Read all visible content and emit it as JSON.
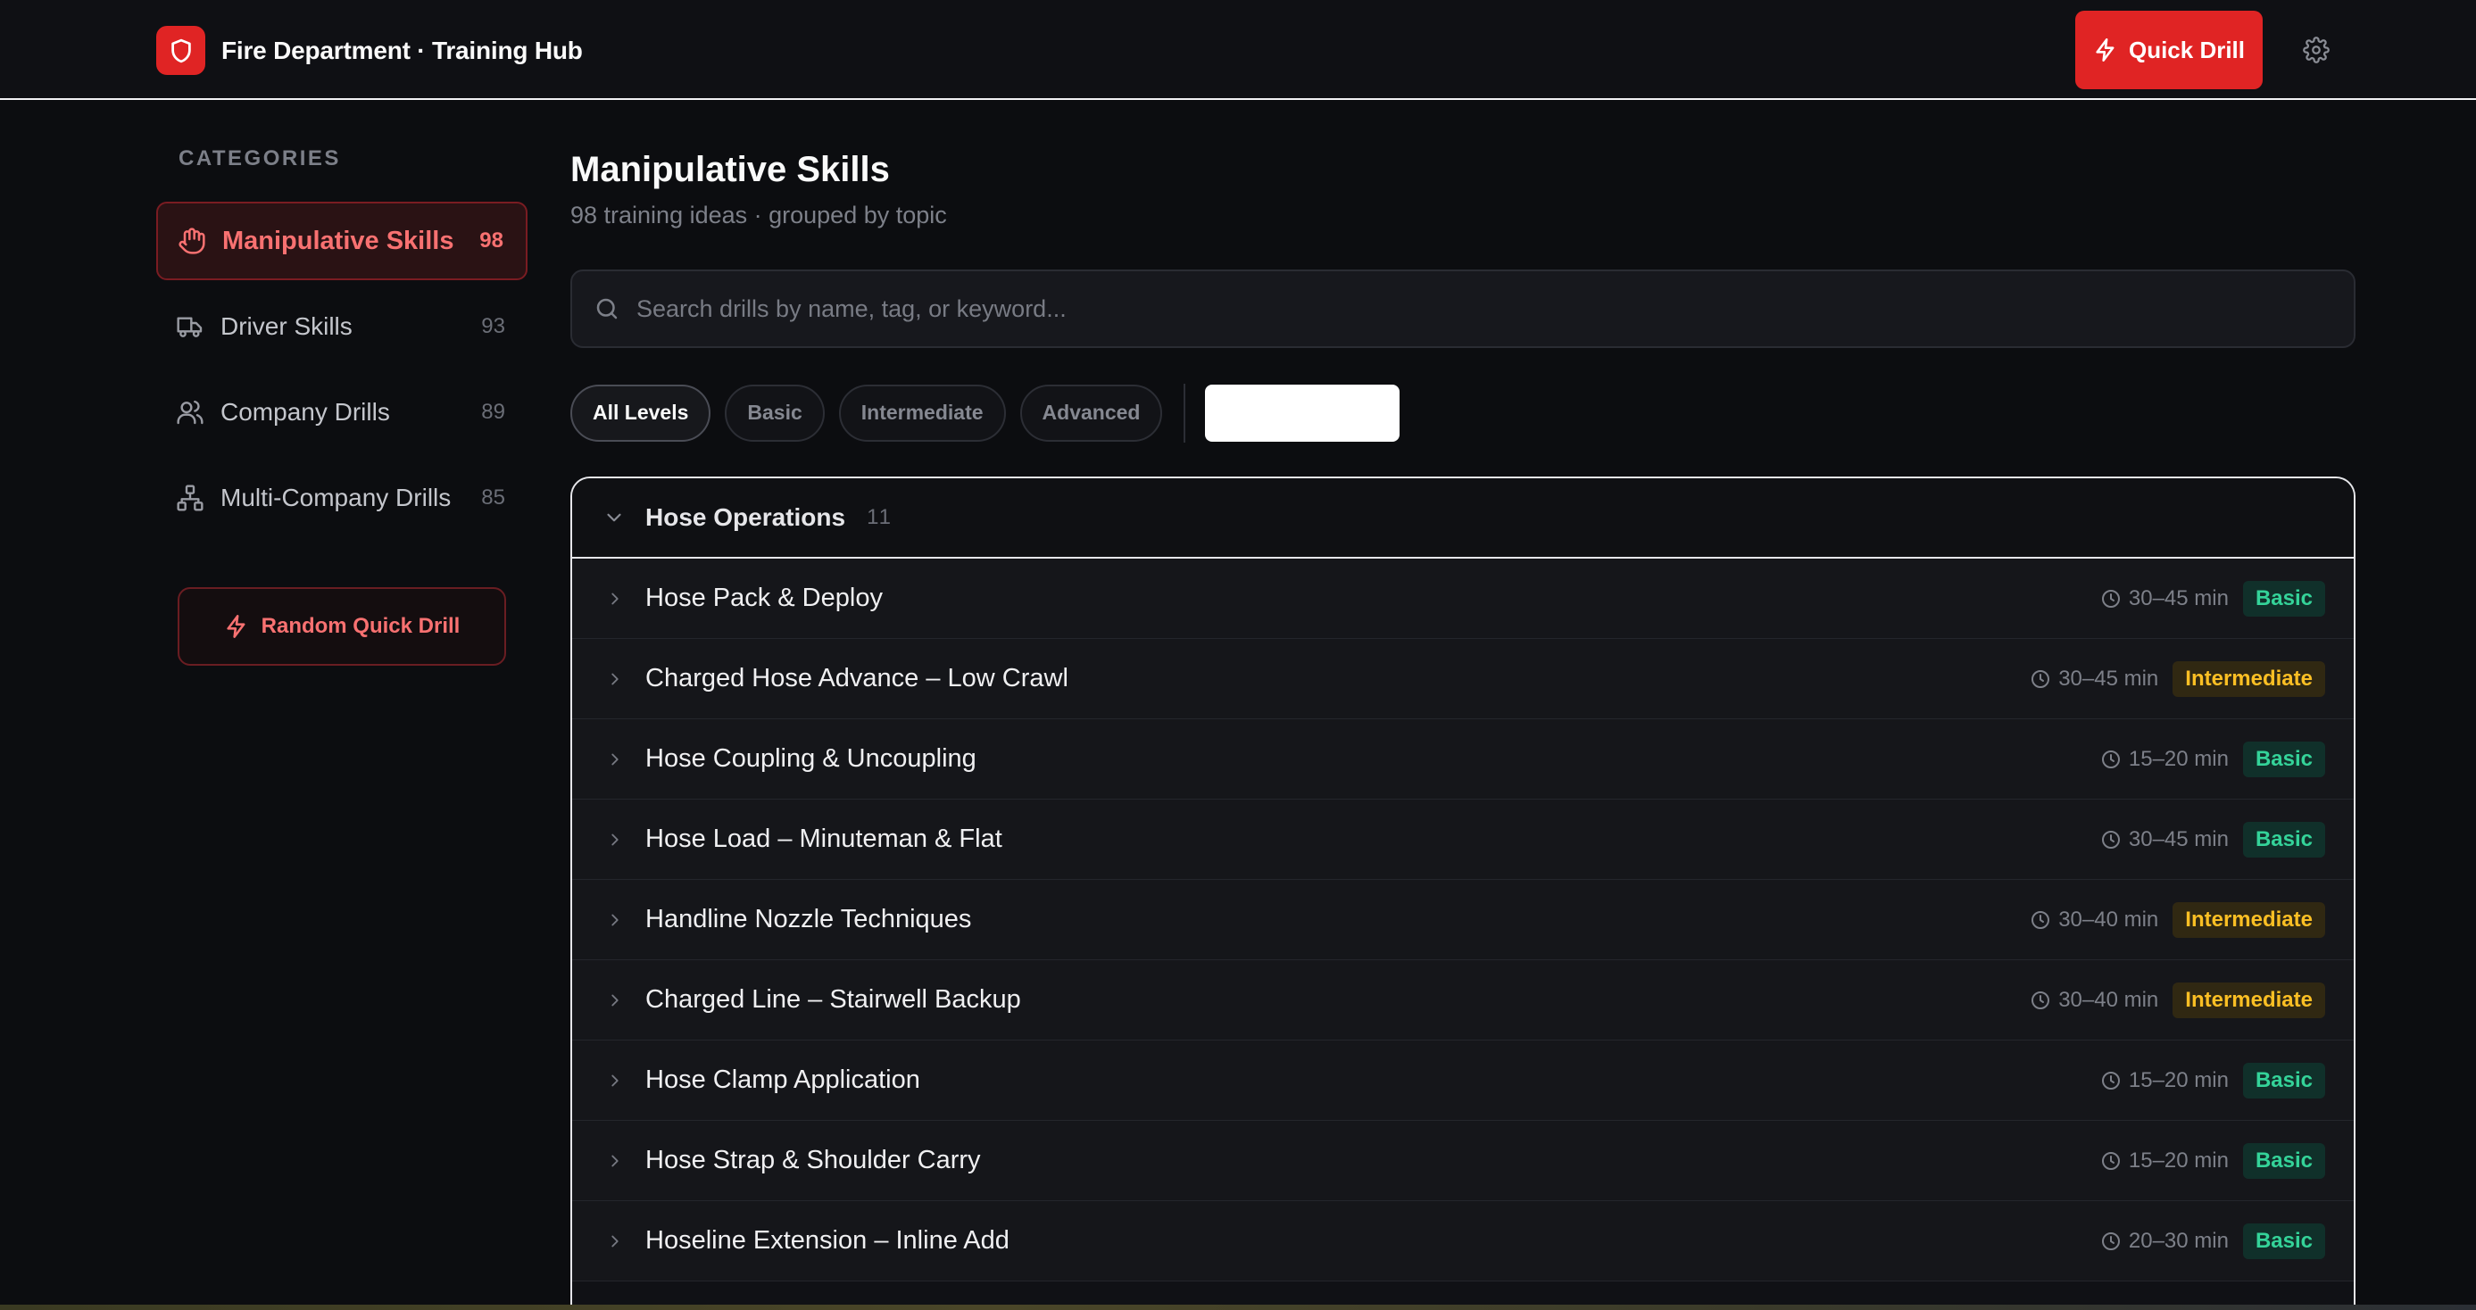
{
  "header": {
    "title": "Fire Department · Training Hub",
    "quick_drill_label": "Quick Drill",
    "logo_icon": "shield-icon",
    "settings_icon": "gear-icon"
  },
  "sidebar": {
    "heading": "CATEGORIES",
    "items": [
      {
        "label": "Manipulative Skills",
        "count": "98",
        "icon": "hand-icon",
        "active": true
      },
      {
        "label": "Driver Skills",
        "count": "93",
        "icon": "truck-icon",
        "active": false
      },
      {
        "label": "Company Drills",
        "count": "89",
        "icon": "users-icon",
        "active": false
      },
      {
        "label": "Multi-Company Drills",
        "count": "85",
        "icon": "network-icon",
        "active": false
      }
    ],
    "random_label": "Random Quick Drill"
  },
  "main": {
    "title": "Manipulative Skills",
    "subtitle": "98 training ideas · grouped by topic",
    "search_placeholder": "Search drills by name, tag, or keyword...",
    "search_value": "",
    "filters": [
      "All Levels",
      "Basic",
      "Intermediate",
      "Advanced"
    ],
    "active_filter": "All Levels",
    "group": {
      "title": "Hose Operations",
      "count": "11",
      "drills": [
        {
          "title": "Hose Pack & Deploy",
          "time": "30–45 min",
          "level": "Basic"
        },
        {
          "title": "Charged Hose Advance – Low Crawl",
          "time": "30–45 min",
          "level": "Intermediate"
        },
        {
          "title": "Hose Coupling & Uncoupling",
          "time": "15–20 min",
          "level": "Basic"
        },
        {
          "title": "Hose Load – Minuteman & Flat",
          "time": "30–45 min",
          "level": "Basic"
        },
        {
          "title": "Handline Nozzle Techniques",
          "time": "30–40 min",
          "level": "Intermediate"
        },
        {
          "title": "Charged Line – Stairwell Backup",
          "time": "30–40 min",
          "level": "Intermediate"
        },
        {
          "title": "Hose Clamp Application",
          "time": "15–20 min",
          "level": "Basic"
        },
        {
          "title": "Hose Strap & Shoulder Carry",
          "time": "15–20 min",
          "level": "Basic"
        },
        {
          "title": "Hoseline Extension – Inline Add",
          "time": "20–30 min",
          "level": "Basic"
        }
      ]
    }
  },
  "colors": {
    "accent": "#e02424",
    "active_text": "#f87171",
    "basic": "#34d399",
    "intermediate": "#fbbf24"
  }
}
